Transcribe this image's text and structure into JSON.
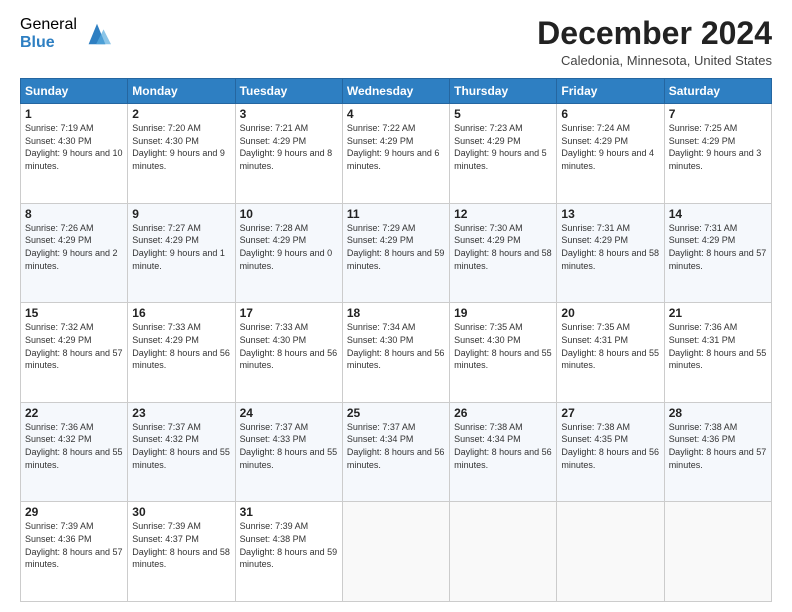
{
  "logo": {
    "general": "General",
    "blue": "Blue"
  },
  "header": {
    "month": "December 2024",
    "location": "Caledonia, Minnesota, United States"
  },
  "days_of_week": [
    "Sunday",
    "Monday",
    "Tuesday",
    "Wednesday",
    "Thursday",
    "Friday",
    "Saturday"
  ],
  "weeks": [
    [
      {
        "day": "1",
        "sunrise": "7:19 AM",
        "sunset": "4:30 PM",
        "daylight": "9 hours and 10 minutes."
      },
      {
        "day": "2",
        "sunrise": "7:20 AM",
        "sunset": "4:30 PM",
        "daylight": "9 hours and 9 minutes."
      },
      {
        "day": "3",
        "sunrise": "7:21 AM",
        "sunset": "4:29 PM",
        "daylight": "9 hours and 8 minutes."
      },
      {
        "day": "4",
        "sunrise": "7:22 AM",
        "sunset": "4:29 PM",
        "daylight": "9 hours and 6 minutes."
      },
      {
        "day": "5",
        "sunrise": "7:23 AM",
        "sunset": "4:29 PM",
        "daylight": "9 hours and 5 minutes."
      },
      {
        "day": "6",
        "sunrise": "7:24 AM",
        "sunset": "4:29 PM",
        "daylight": "9 hours and 4 minutes."
      },
      {
        "day": "7",
        "sunrise": "7:25 AM",
        "sunset": "4:29 PM",
        "daylight": "9 hours and 3 minutes."
      }
    ],
    [
      {
        "day": "8",
        "sunrise": "7:26 AM",
        "sunset": "4:29 PM",
        "daylight": "9 hours and 2 minutes."
      },
      {
        "day": "9",
        "sunrise": "7:27 AM",
        "sunset": "4:29 PM",
        "daylight": "9 hours and 1 minute."
      },
      {
        "day": "10",
        "sunrise": "7:28 AM",
        "sunset": "4:29 PM",
        "daylight": "9 hours and 0 minutes."
      },
      {
        "day": "11",
        "sunrise": "7:29 AM",
        "sunset": "4:29 PM",
        "daylight": "8 hours and 59 minutes."
      },
      {
        "day": "12",
        "sunrise": "7:30 AM",
        "sunset": "4:29 PM",
        "daylight": "8 hours and 58 minutes."
      },
      {
        "day": "13",
        "sunrise": "7:31 AM",
        "sunset": "4:29 PM",
        "daylight": "8 hours and 58 minutes."
      },
      {
        "day": "14",
        "sunrise": "7:31 AM",
        "sunset": "4:29 PM",
        "daylight": "8 hours and 57 minutes."
      }
    ],
    [
      {
        "day": "15",
        "sunrise": "7:32 AM",
        "sunset": "4:29 PM",
        "daylight": "8 hours and 57 minutes."
      },
      {
        "day": "16",
        "sunrise": "7:33 AM",
        "sunset": "4:29 PM",
        "daylight": "8 hours and 56 minutes."
      },
      {
        "day": "17",
        "sunrise": "7:33 AM",
        "sunset": "4:30 PM",
        "daylight": "8 hours and 56 minutes."
      },
      {
        "day": "18",
        "sunrise": "7:34 AM",
        "sunset": "4:30 PM",
        "daylight": "8 hours and 56 minutes."
      },
      {
        "day": "19",
        "sunrise": "7:35 AM",
        "sunset": "4:30 PM",
        "daylight": "8 hours and 55 minutes."
      },
      {
        "day": "20",
        "sunrise": "7:35 AM",
        "sunset": "4:31 PM",
        "daylight": "8 hours and 55 minutes."
      },
      {
        "day": "21",
        "sunrise": "7:36 AM",
        "sunset": "4:31 PM",
        "daylight": "8 hours and 55 minutes."
      }
    ],
    [
      {
        "day": "22",
        "sunrise": "7:36 AM",
        "sunset": "4:32 PM",
        "daylight": "8 hours and 55 minutes."
      },
      {
        "day": "23",
        "sunrise": "7:37 AM",
        "sunset": "4:32 PM",
        "daylight": "8 hours and 55 minutes."
      },
      {
        "day": "24",
        "sunrise": "7:37 AM",
        "sunset": "4:33 PM",
        "daylight": "8 hours and 55 minutes."
      },
      {
        "day": "25",
        "sunrise": "7:37 AM",
        "sunset": "4:34 PM",
        "daylight": "8 hours and 56 minutes."
      },
      {
        "day": "26",
        "sunrise": "7:38 AM",
        "sunset": "4:34 PM",
        "daylight": "8 hours and 56 minutes."
      },
      {
        "day": "27",
        "sunrise": "7:38 AM",
        "sunset": "4:35 PM",
        "daylight": "8 hours and 56 minutes."
      },
      {
        "day": "28",
        "sunrise": "7:38 AM",
        "sunset": "4:36 PM",
        "daylight": "8 hours and 57 minutes."
      }
    ],
    [
      {
        "day": "29",
        "sunrise": "7:39 AM",
        "sunset": "4:36 PM",
        "daylight": "8 hours and 57 minutes."
      },
      {
        "day": "30",
        "sunrise": "7:39 AM",
        "sunset": "4:37 PM",
        "daylight": "8 hours and 58 minutes."
      },
      {
        "day": "31",
        "sunrise": "7:39 AM",
        "sunset": "4:38 PM",
        "daylight": "8 hours and 59 minutes."
      },
      null,
      null,
      null,
      null
    ]
  ]
}
